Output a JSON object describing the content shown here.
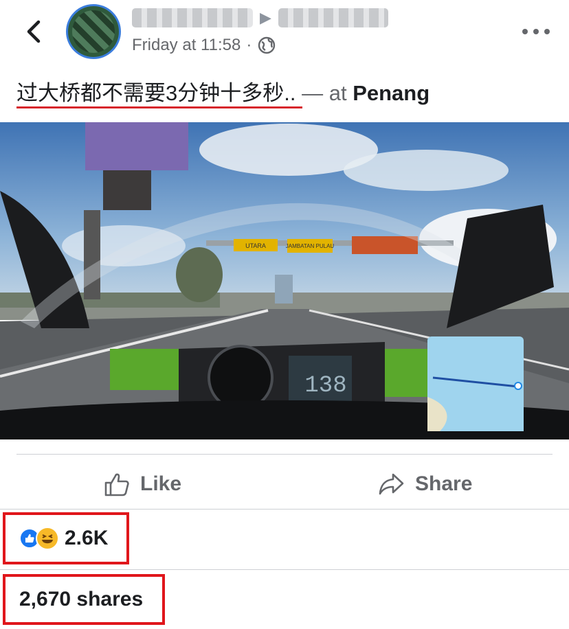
{
  "header": {
    "time": "Friday at 11:58",
    "separator": "·",
    "audience_icon": "globe-icon",
    "back_icon": "back-arrow-icon",
    "more_icon": "more-options-icon"
  },
  "post": {
    "text": "过大桥都不需要3分钟十多秒..",
    "at_prefix": "— at",
    "place": "Penang"
  },
  "video": {
    "speedometer_reading": "138",
    "sign_left": "UTARA",
    "sign_mid": "JAMBATAN PULAU",
    "mute_icon": "muted-speaker-icon"
  },
  "actions": {
    "like_label": "Like",
    "share_label": "Share"
  },
  "stats": {
    "reaction_count": "2.6K",
    "shares": "2,670 shares"
  },
  "colors": {
    "accent": "#1877f2",
    "highlight": "#e0161b",
    "muted_text": "#65676b"
  }
}
